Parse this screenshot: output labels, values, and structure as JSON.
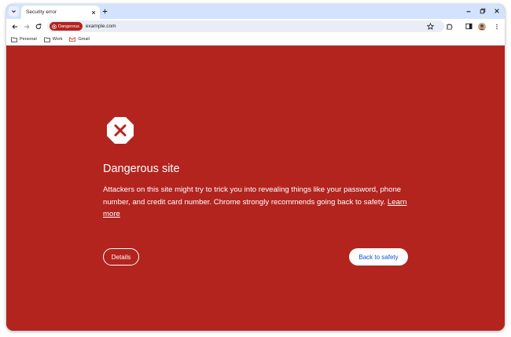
{
  "browser": {
    "tab": {
      "title": "Security error"
    },
    "omnibox": {
      "chip_label": "Dangerous",
      "url": "example.com"
    },
    "bookmarks": [
      {
        "label": "Personal",
        "icon": "folder-icon"
      },
      {
        "label": "Work",
        "icon": "folder-icon"
      },
      {
        "label": "Gmail",
        "icon": "gmail-icon"
      }
    ]
  },
  "interstitial": {
    "icon": "stop-octagon-icon",
    "heading": "Dangerous site",
    "body": "Attackers on this site might try to trick you into revealing things like your password, phone number, and credit card number. Chrome strongly recommends going back to safety.",
    "learn_more": "Learn more",
    "details_label": "Details",
    "back_label": "Back to safety"
  },
  "colors": {
    "danger_red": "#b3241f",
    "tab_strip": "#d3e3fd",
    "omnibox_bg": "#e9eef6",
    "primary_blue": "#0b57d0"
  }
}
